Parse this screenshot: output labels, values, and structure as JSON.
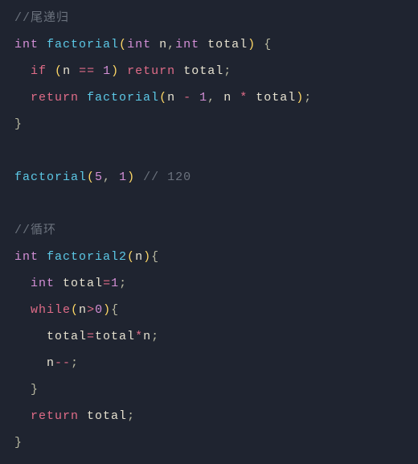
{
  "code": {
    "c1": "//尾递归",
    "l2_int1": "int",
    "l2_fn": "factorial",
    "l2_lp": "(",
    "l2_int2": "int",
    "l2_n": "n",
    "l2_cm": ",",
    "l2_int3": "int",
    "l2_total": "total",
    "l2_rp": ")",
    "l2_lb": "{",
    "l3_if": "if",
    "l3_lp": "(",
    "l3_n": "n",
    "l3_eq": "==",
    "l3_1": "1",
    "l3_rp": ")",
    "l3_ret": "return",
    "l3_total": "total",
    "l3_sc": ";",
    "l4_ret": "return",
    "l4_fn": "factorial",
    "l4_lp": "(",
    "l4_n1": "n",
    "l4_minus": "-",
    "l4_1": "1",
    "l4_cm": ",",
    "l4_n2": "n",
    "l4_star": "*",
    "l4_total": "total",
    "l4_rp": ")",
    "l4_sc": ";",
    "l5_rb": "}",
    "l7_fn": "factorial",
    "l7_lp": "(",
    "l7_5": "5",
    "l7_cm": ",",
    "l7_1": "1",
    "l7_rp": ")",
    "l7_c": "// 120",
    "c2": "//循环",
    "l10_int": "int",
    "l10_fn": "factorial2",
    "l10_lp": "(",
    "l10_n": "n",
    "l10_rp": ")",
    "l10_lb": "{",
    "l11_int": "int",
    "l11_total": "total",
    "l11_eq": "=",
    "l11_1": "1",
    "l11_sc": ";",
    "l12_while": "while",
    "l12_lp": "(",
    "l12_n": "n",
    "l12_gt": ">",
    "l12_0": "0",
    "l12_rp": ")",
    "l12_lb": "{",
    "l13_total1": "total",
    "l13_eq": "=",
    "l13_total2": "total",
    "l13_star": "*",
    "l13_n": "n",
    "l13_sc": ";",
    "l14_n": "n",
    "l14_dec": "--",
    "l14_sc": ";",
    "l15_rb": "}",
    "l16_ret": "return",
    "l16_total": "total",
    "l16_sc": ";",
    "l17_rb": "}"
  }
}
